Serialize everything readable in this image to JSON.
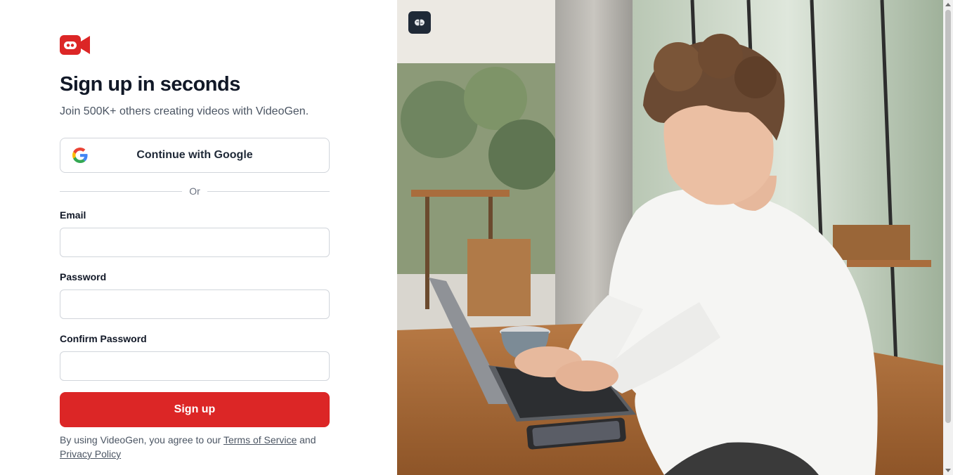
{
  "brand": {
    "name": "VideoGen",
    "logo_icon": "video-camera-robot-icon",
    "accent_color": "#dc2626"
  },
  "form": {
    "title": "Sign up in seconds",
    "subtitle": "Join 500K+ others creating videos with VideoGen.",
    "google_button_label": "Continue with Google",
    "divider_text": "Or",
    "email_label": "Email",
    "email_value": "",
    "password_label": "Password",
    "password_value": "",
    "confirm_password_label": "Confirm Password",
    "confirm_password_value": "",
    "submit_label": "Sign up"
  },
  "legal": {
    "prefix": "By using VideoGen, you agree to our ",
    "terms_link": "Terms of Service",
    "conjunction": " and",
    "privacy_link": "Privacy Policy"
  },
  "hero": {
    "image_icon": "photo-man-on-laptop-cafe",
    "badge_icon": "brain-icon"
  }
}
